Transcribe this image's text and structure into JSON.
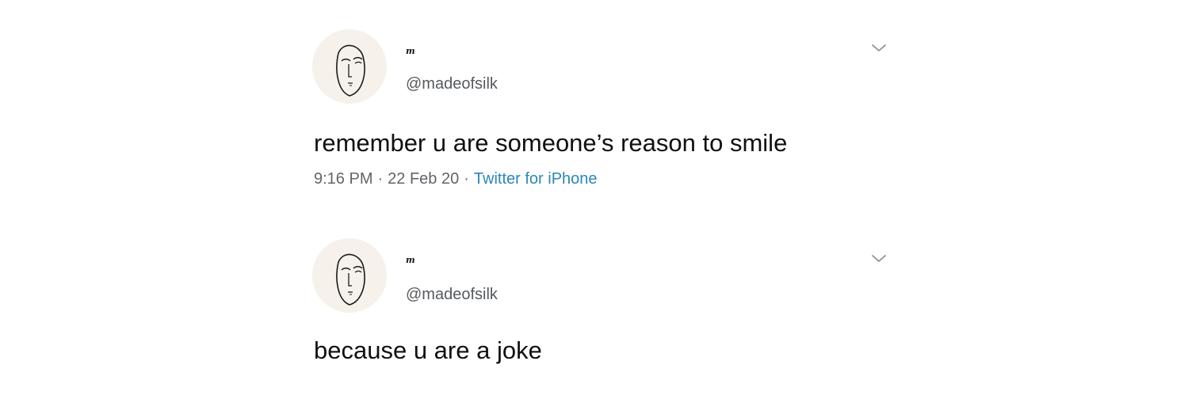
{
  "tweets": [
    {
      "display_name": "m",
      "handle": "@madeofsilk",
      "text": "remember u are someone’s reason to smile",
      "time": "9:16 PM",
      "date": "22 Feb 20",
      "source": "Twitter for iPhone",
      "separator": "·",
      "avatar_icon": "line-drawn-face-icon",
      "menu_icon": "chevron-down-icon"
    },
    {
      "display_name": "m",
      "handle": "@madeofsilk",
      "text": "because u are a joke",
      "avatar_icon": "line-drawn-face-icon",
      "menu_icon": "chevron-down-icon"
    }
  ],
  "colors": {
    "background": "#ffffff",
    "text": "#0e1114",
    "secondary_text": "#616569",
    "link": "#2b87b8",
    "avatar_bg": "#f6f1ea"
  }
}
